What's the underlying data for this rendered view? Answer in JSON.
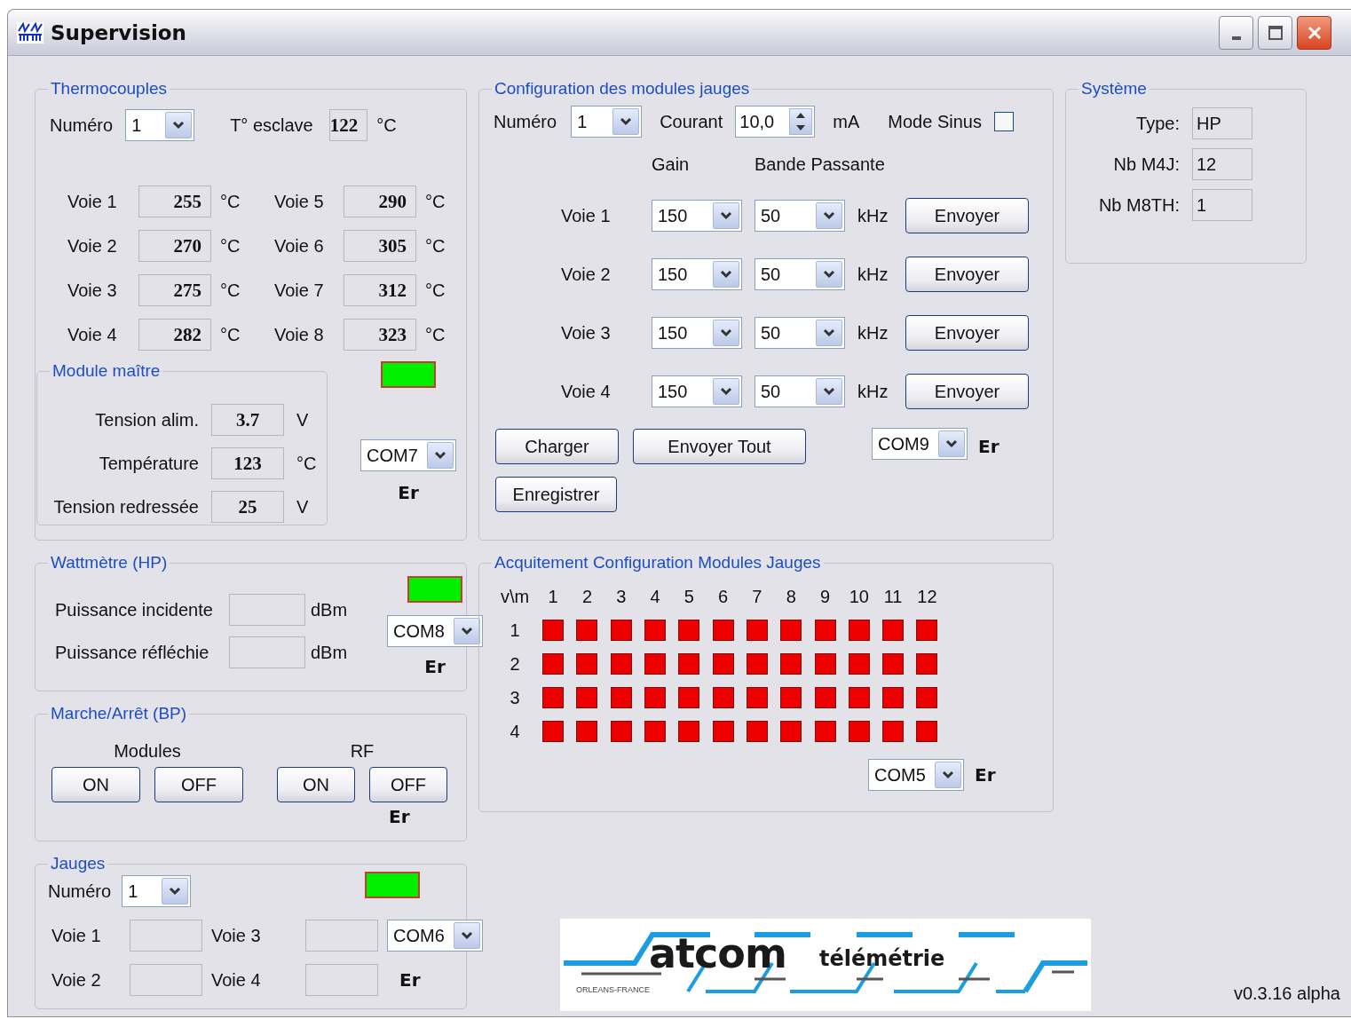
{
  "window": {
    "title": "Supervision"
  },
  "thermocouples": {
    "title": "Thermocouples",
    "number_label": "Numéro",
    "number": "1",
    "slave_label": "T° esclave",
    "slave_value": "122",
    "slave_unit": "°C",
    "channels": [
      {
        "label": "Voie 1",
        "value": "255",
        "unit": "°C"
      },
      {
        "label": "Voie 2",
        "value": "270",
        "unit": "°C"
      },
      {
        "label": "Voie 3",
        "value": "275",
        "unit": "°C"
      },
      {
        "label": "Voie 4",
        "value": "282",
        "unit": "°C"
      },
      {
        "label": "Voie 5",
        "value": "290",
        "unit": "°C"
      },
      {
        "label": "Voie 6",
        "value": "305",
        "unit": "°C"
      },
      {
        "label": "Voie 7",
        "value": "312",
        "unit": "°C"
      },
      {
        "label": "Voie 8",
        "value": "323",
        "unit": "°C"
      }
    ],
    "master": {
      "title": "Module maître",
      "rows": [
        {
          "label": "Tension alim.",
          "value": "3.7",
          "unit": "V"
        },
        {
          "label": "Température",
          "value": "123",
          "unit": "°C"
        },
        {
          "label": "Tension redressée",
          "value": "25",
          "unit": "V"
        }
      ]
    },
    "led_ok": true,
    "port": "COM7",
    "port_status": "Er"
  },
  "wattmeter": {
    "title": "Wattmètre (HP)",
    "rows": [
      {
        "label": "Puissance incidente",
        "unit": "dBm"
      },
      {
        "label": "Puissance réfléchie",
        "unit": "dBm"
      }
    ],
    "led_ok": true,
    "port": "COM8",
    "port_status": "Er"
  },
  "power": {
    "title": "Marche/Arrêt (BP)",
    "groups": [
      {
        "label": "Modules",
        "buttons": [
          "ON",
          "OFF"
        ]
      },
      {
        "label": "RF",
        "buttons": [
          "ON",
          "OFF"
        ]
      }
    ],
    "port_status": "Er"
  },
  "gauges": {
    "title": "Jauges",
    "number_label": "Numéro",
    "number": "1",
    "led_ok": true,
    "channels": [
      {
        "label": "Voie 1"
      },
      {
        "label": "Voie 2"
      },
      {
        "label": "Voie 3"
      },
      {
        "label": "Voie 4"
      }
    ],
    "port": "COM6",
    "port_status": "Er"
  },
  "config": {
    "title": "Configuration des modules jauges",
    "number_label": "Numéro",
    "number": "1",
    "current_label": "Courant",
    "current": "10,0",
    "current_unit": "mA",
    "sine_label": "Mode Sinus",
    "sine_checked": false,
    "gain_header": "Gain",
    "band_header": "Bande Passante",
    "channels": [
      {
        "label": "Voie 1",
        "gain": "150",
        "band": "50",
        "unit": "kHz",
        "button": "Envoyer"
      },
      {
        "label": "Voie 2",
        "gain": "150",
        "band": "50",
        "unit": "kHz",
        "button": "Envoyer"
      },
      {
        "label": "Voie 3",
        "gain": "150",
        "band": "50",
        "unit": "kHz",
        "button": "Envoyer"
      },
      {
        "label": "Voie 4",
        "gain": "150",
        "band": "50",
        "unit": "kHz",
        "button": "Envoyer"
      }
    ],
    "load_button": "Charger",
    "send_all_button": "Envoyer Tout",
    "save_button": "Enregistrer",
    "port": "COM9",
    "port_status": "Er"
  },
  "ack": {
    "title": "Acquitement Configuration Modules Jauges",
    "corner": "v\\m",
    "columns": [
      "1",
      "2",
      "3",
      "4",
      "5",
      "6",
      "7",
      "8",
      "9",
      "10",
      "11",
      "12"
    ],
    "rows": [
      {
        "label": "1",
        "cells": [
          {
            "ok": false
          },
          {
            "ok": false
          },
          {
            "ok": false
          },
          {
            "ok": false
          },
          {
            "ok": false
          },
          {
            "ok": false
          },
          {
            "ok": false
          },
          {
            "ok": false
          },
          {
            "ok": false
          },
          {
            "ok": false
          },
          {
            "ok": false
          },
          {
            "ok": false
          }
        ]
      },
      {
        "label": "2",
        "cells": [
          {
            "ok": false
          },
          {
            "ok": false
          },
          {
            "ok": false
          },
          {
            "ok": false
          },
          {
            "ok": false
          },
          {
            "ok": false
          },
          {
            "ok": false
          },
          {
            "ok": false
          },
          {
            "ok": false
          },
          {
            "ok": false
          },
          {
            "ok": false
          },
          {
            "ok": false
          }
        ]
      },
      {
        "label": "3",
        "cells": [
          {
            "ok": false
          },
          {
            "ok": false
          },
          {
            "ok": false
          },
          {
            "ok": false
          },
          {
            "ok": false
          },
          {
            "ok": false
          },
          {
            "ok": false
          },
          {
            "ok": false
          },
          {
            "ok": false
          },
          {
            "ok": false
          },
          {
            "ok": false
          },
          {
            "ok": false
          }
        ]
      },
      {
        "label": "4",
        "cells": [
          {
            "ok": false
          },
          {
            "ok": false
          },
          {
            "ok": false
          },
          {
            "ok": false
          },
          {
            "ok": false
          },
          {
            "ok": false
          },
          {
            "ok": false
          },
          {
            "ok": false
          },
          {
            "ok": false
          },
          {
            "ok": false
          },
          {
            "ok": false
          },
          {
            "ok": false
          }
        ]
      }
    ],
    "port": "COM5",
    "port_status": "Er"
  },
  "system": {
    "title": "Système",
    "rows": [
      {
        "label": "Type:",
        "value": "HP"
      },
      {
        "label": "Nb M4J:",
        "value": "12"
      },
      {
        "label": "Nb M8TH:",
        "value": "1"
      }
    ]
  },
  "logo": {
    "name": "atcom",
    "tagline": "télémétrie",
    "place": "ORLEANS-FRANCE"
  },
  "version": "v0.3.16 alpha"
}
